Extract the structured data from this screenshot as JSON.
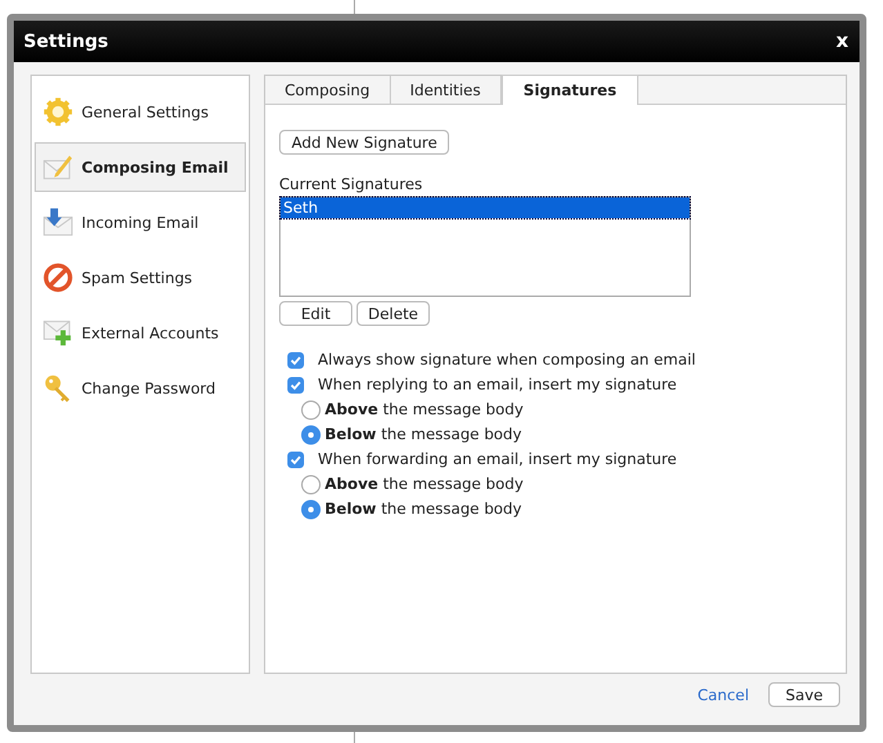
{
  "window": {
    "title": "Settings",
    "close": "x"
  },
  "sidebar": {
    "items": [
      {
        "label": "General Settings",
        "selected": false
      },
      {
        "label": "Composing Email",
        "selected": true
      },
      {
        "label": "Incoming Email",
        "selected": false
      },
      {
        "label": "Spam Settings",
        "selected": false
      },
      {
        "label": "External Accounts",
        "selected": false
      },
      {
        "label": "Change Password",
        "selected": false
      }
    ]
  },
  "tabs": [
    {
      "label": "Composing",
      "selected": false
    },
    {
      "label": "Identities",
      "selected": false
    },
    {
      "label": "Signatures",
      "selected": true
    }
  ],
  "add_button": "Add New Signature",
  "signatures": {
    "label": "Current Signatures",
    "items": [
      {
        "label": "Seth",
        "selected": true
      }
    ]
  },
  "list_buttons": [
    "Edit",
    "Delete"
  ],
  "options": [
    {
      "kind": "checkbox",
      "label": "Always show signature when composing an email",
      "checked": true
    },
    {
      "kind": "checkbox",
      "label": "When replying to an email, insert my signature",
      "checked": true
    },
    {
      "kind": "radio",
      "label": "**Above** the message body",
      "selected": false
    },
    {
      "kind": "radio",
      "label": "**Below** the message body",
      "selected": true
    },
    {
      "kind": "checkbox",
      "label": "When forwarding an email, insert my signature",
      "checked": true
    },
    {
      "kind": "radio",
      "label": "**Above** the message body",
      "selected": false
    },
    {
      "kind": "radio",
      "label": "**Below** the message body",
      "selected": true
    }
  ],
  "footer": {
    "cancel": "Cancel",
    "save": "Save"
  }
}
